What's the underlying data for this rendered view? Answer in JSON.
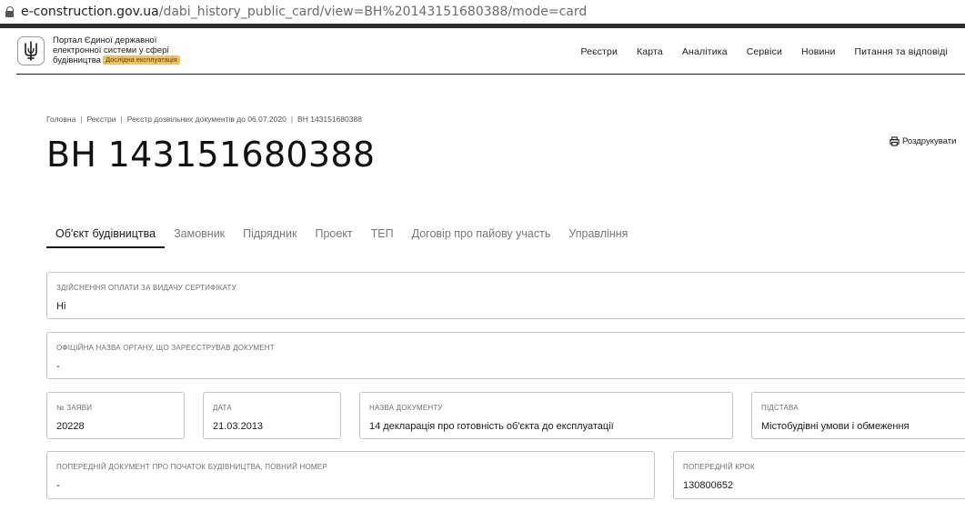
{
  "browser": {
    "url_host": "e-construction.gov.ua",
    "url_path": "/dabi_history_public_card/view=ВН%20143151680388/mode=card"
  },
  "header": {
    "portal_line1": "Портал Єдиної державної",
    "portal_line2": "електронної системи у сфері",
    "portal_line3": "будівництва",
    "badge": "Дослідна експлуатація",
    "nav": [
      "Реєстри",
      "Карта",
      "Аналітика",
      "Сервіси",
      "Новини",
      "Питання та відповіді"
    ]
  },
  "breadcrumb": [
    "Головна",
    "Реєстри",
    "Реєстр дозвільних документів до 06.07.2020",
    "ВН 143151680388"
  ],
  "title": "ВН 143151680388",
  "print_label": "Роздрукувати",
  "tabs": [
    "Об'єкт будівництва",
    "Замовник",
    "Підрядник",
    "Проект",
    "ТЕП",
    "Договір про пайову участь",
    "Управління"
  ],
  "fields": {
    "payment": {
      "label": "Здійснення оплати за видачу сертифікату",
      "value": "Ні"
    },
    "authority": {
      "label": "Офіційна назва органу, що зареєстрував документ",
      "value": "-"
    },
    "app_no": {
      "label": "№ заяви",
      "value": "20228"
    },
    "date": {
      "label": "Дата",
      "value": "21.03.2013"
    },
    "doc_name": {
      "label": "Назва документу",
      "value": "14 декларація про готовність об'єкта до експлуатації"
    },
    "basis": {
      "label": "Підстава",
      "value": "Містобудівні умови і обмеження"
    },
    "prev_doc": {
      "label": "Попередній документ про початок будівництва, повний номер",
      "value": "-"
    },
    "prev_step": {
      "label": "Попередній крок",
      "value": "130800652"
    }
  }
}
